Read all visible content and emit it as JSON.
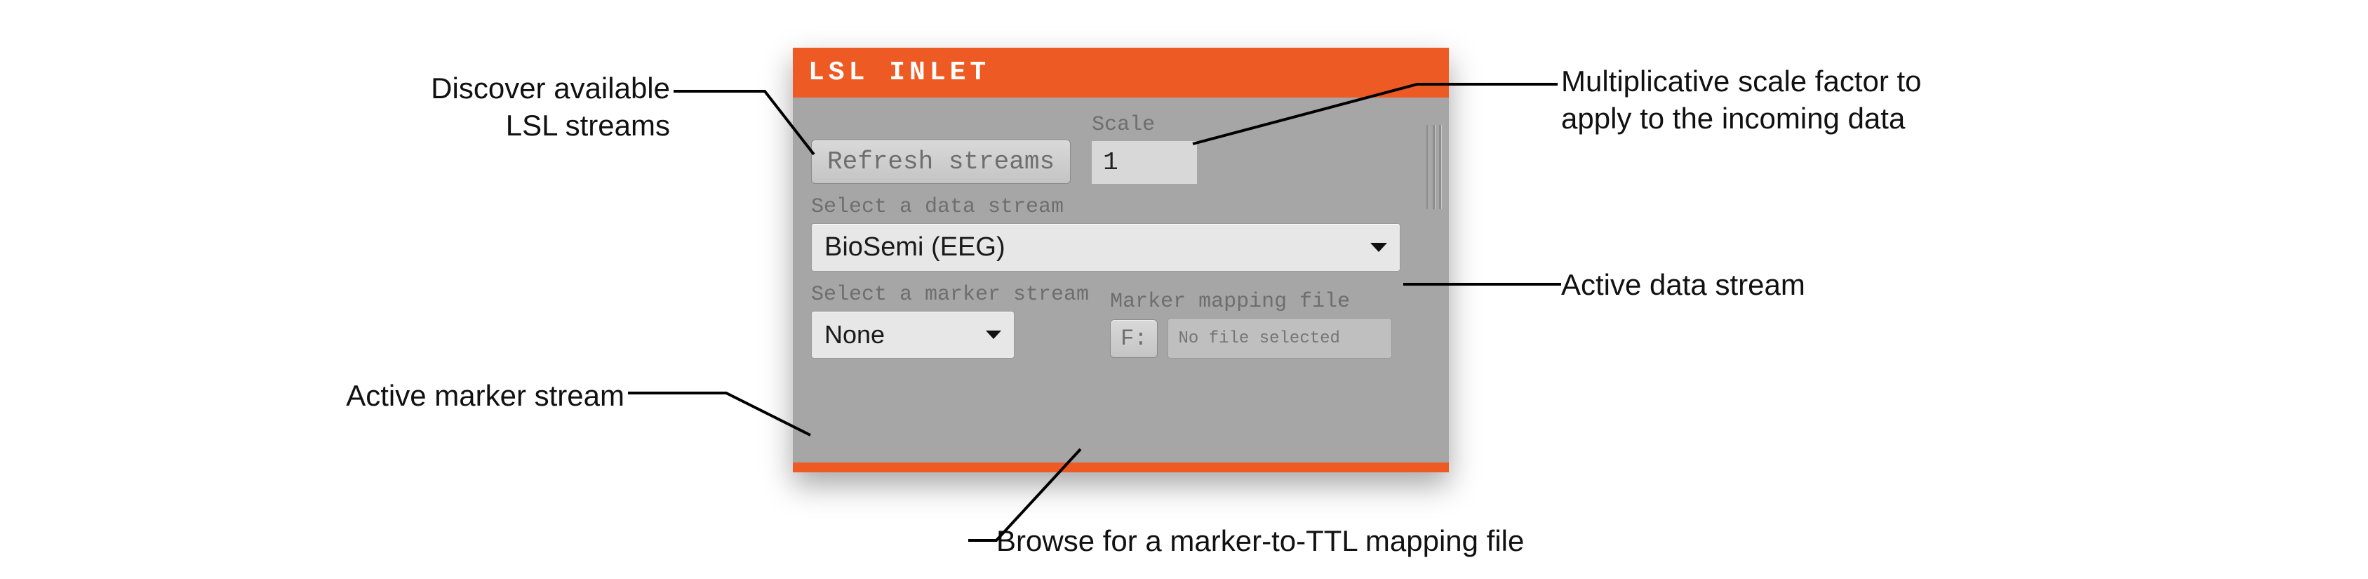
{
  "panel": {
    "title": "LSL INLET",
    "refresh_button": "Refresh streams",
    "scale_label": "Scale",
    "scale_value": "1",
    "data_stream_label": "Select a data stream",
    "data_stream_value": "BioSemi (EEG)",
    "marker_stream_label": "Select a marker stream",
    "marker_stream_value": "None",
    "marker_mapping_label": "Marker mapping file",
    "file_button": "F:",
    "file_status": "No file selected"
  },
  "callouts": {
    "refresh": "Discover available\nLSL streams",
    "scale": "Multiplicative scale factor to\napply to the incoming data",
    "data_stream": "Active data stream",
    "marker_stream": "Active marker stream",
    "file_browse": "Browse for a marker-to-TTL mapping file"
  }
}
